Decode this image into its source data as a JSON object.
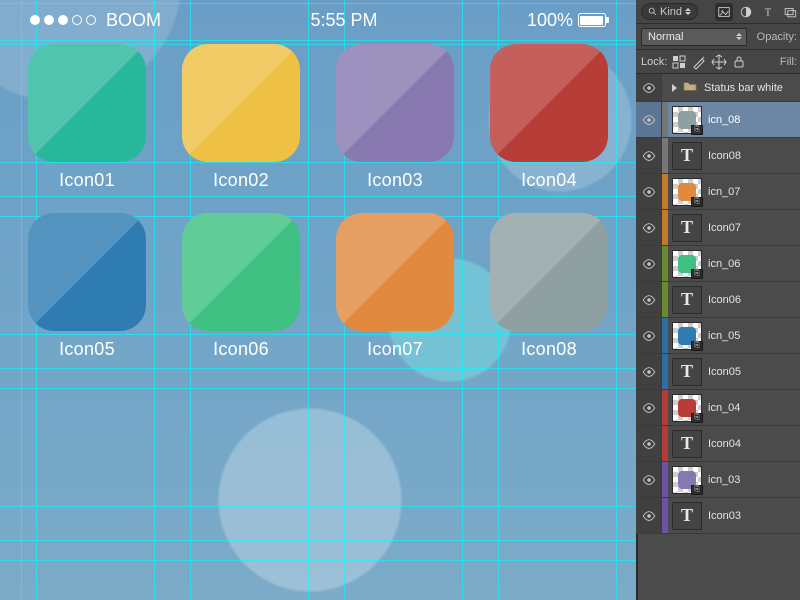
{
  "status": {
    "carrier": "BOOM",
    "time": "5:55 PM",
    "battery": "100%"
  },
  "icons": [
    {
      "label": "Icon01",
      "color": "#29b79b"
    },
    {
      "label": "Icon02",
      "color": "#eec044"
    },
    {
      "label": "Icon03",
      "color": "#8779b0"
    },
    {
      "label": "Icon04",
      "color": "#b83c38"
    },
    {
      "label": "Icon05",
      "color": "#2f7cb2"
    },
    {
      "label": "Icon06",
      "color": "#3fc181"
    },
    {
      "label": "Icon07",
      "color": "#e18a3f"
    },
    {
      "label": "Icon08",
      "color": "#8fa0a2"
    }
  ],
  "panel": {
    "kind_label": "Kind",
    "blend_mode": "Normal",
    "opacity_label": "Opacity:",
    "lock_label": "Lock:",
    "fill_label": "Fill:",
    "status_group": "Status bar white",
    "swatches": {
      "gray": "#777777",
      "orange": "#c5792a",
      "green": "#6a8a2f",
      "blue": "#2e6ea6",
      "red": "#b53c36",
      "purple": "#6d53a1"
    },
    "layers": [
      {
        "kind": "group",
        "name": "Status bar white",
        "swatch": "none",
        "selected": false
      },
      {
        "kind": "smart",
        "name": "icn_08",
        "swatch": "gray",
        "mini": "#8fa0a2",
        "selected": true
      },
      {
        "kind": "text",
        "name": "Icon08",
        "swatch": "gray",
        "selected": false
      },
      {
        "kind": "smart",
        "name": "icn_07",
        "swatch": "orange",
        "mini": "#e18a3f",
        "selected": false
      },
      {
        "kind": "text",
        "name": "Icon07",
        "swatch": "orange",
        "selected": false
      },
      {
        "kind": "smart",
        "name": "icn_06",
        "swatch": "green",
        "mini": "#3fc181",
        "selected": false
      },
      {
        "kind": "text",
        "name": "Icon06",
        "swatch": "green",
        "selected": false
      },
      {
        "kind": "smart",
        "name": "icn_05",
        "swatch": "blue",
        "mini": "#2f7cb2",
        "selected": false
      },
      {
        "kind": "text",
        "name": "Icon05",
        "swatch": "blue",
        "selected": false
      },
      {
        "kind": "smart",
        "name": "icn_04",
        "swatch": "red",
        "mini": "#b83c38",
        "selected": false
      },
      {
        "kind": "text",
        "name": "Icon04",
        "swatch": "red",
        "selected": false
      },
      {
        "kind": "smart",
        "name": "icn_03",
        "swatch": "purple",
        "mini": "#8779b0",
        "selected": false
      },
      {
        "kind": "text",
        "name": "Icon03",
        "swatch": "purple",
        "selected": false
      }
    ]
  }
}
